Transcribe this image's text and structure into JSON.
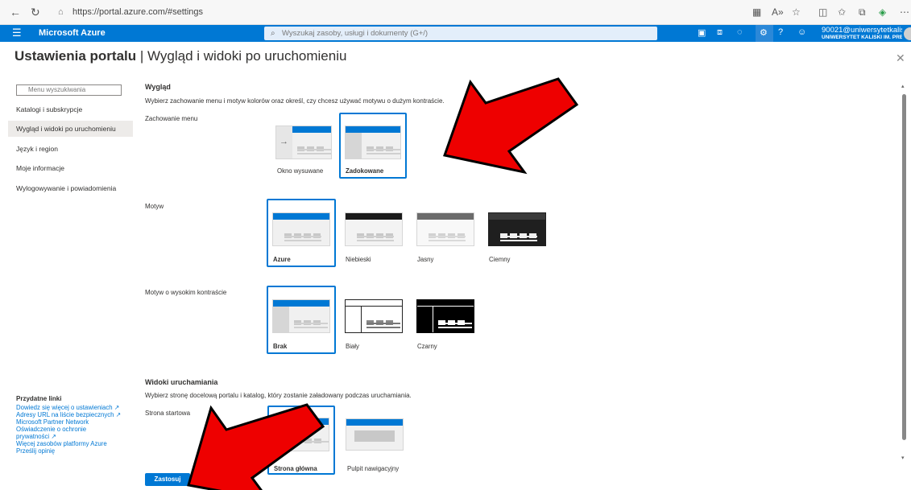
{
  "browser": {
    "url": "https://portal.azure.com/#settings",
    "icons": [
      "back-icon",
      "refresh-icon",
      "lock-icon",
      "grid-icon",
      "read-aloud-icon",
      "favorite-icon",
      "split-screen-icon",
      "favorites-bar-icon",
      "collections-icon",
      "extensions-icon",
      "more-icon"
    ]
  },
  "azure": {
    "menu_icon": "☰",
    "brand": "Microsoft Azure",
    "search_placeholder": "Wyszukaj zasoby, usługi i dokumenty (G+/)",
    "user": "90021@uniwersytetkalis...",
    "org": "UNIWERSYTET KALISKI IM. PREZ..."
  },
  "page": {
    "title_bold": "Ustawienia portalu",
    "title_sep": " | ",
    "title_rest": "Wygląd i widoki po uruchomieniu"
  },
  "sidebar": {
    "search_placeholder": "Menu wyszukiwania",
    "items": [
      {
        "label": "Katalogi i subskrypcje"
      },
      {
        "label": "Wygląd i widoki po uruchomieniu"
      },
      {
        "label": "Język i region"
      },
      {
        "label": "Moje informacje"
      },
      {
        "label": "Wylogowywanie i powiadomienia"
      }
    ],
    "selected_index": 1,
    "helpful_title": "Przydatne linki",
    "links": [
      "Dowiedz się więcej o ustawieniach ↗",
      "Adresy URL na liście bezpiecznych ↗",
      "Microsoft Partner Network",
      "Oświadczenie o ochronie",
      "prywatności ↗",
      "Więcej zasobów platformy Azure",
      "Prześlij opinię"
    ]
  },
  "appearance": {
    "heading": "Wygląd",
    "desc": "Wybierz zachowanie menu i motyw kolorów oraz określ, czy chcesz używać motywu o dużym kontraście.",
    "menu_behavior": {
      "label": "Zachowanie menu",
      "options": [
        "Okno wysuwane",
        "Zadokowane"
      ],
      "selected": "Zadokowane"
    },
    "theme": {
      "label": "Motyw",
      "options": [
        "Azure",
        "Niebieski",
        "Jasny",
        "Ciemny"
      ],
      "selected": "Azure"
    },
    "high_contrast": {
      "label": "Motyw o wysokim kontraście",
      "options": [
        "Brak",
        "Biały",
        "Czarny"
      ],
      "selected": "Brak"
    }
  },
  "startup": {
    "heading": "Widoki uruchamiania",
    "desc": "Wybierz stronę docelową portalu i katalog, który zostanie załadowany podczas uruchamiania.",
    "start_page": {
      "label": "Strona startowa",
      "options": [
        "Strona główna",
        "Pulpit nawigacyjny"
      ],
      "selected": "Strona główna"
    }
  },
  "footer": {
    "apply": "Zastosuj",
    "discard": "Odrzuć zmiany",
    "discard_visible": "ny"
  },
  "colors": {
    "accent": "#0078d4",
    "annotation_arrow": "#e00000"
  }
}
